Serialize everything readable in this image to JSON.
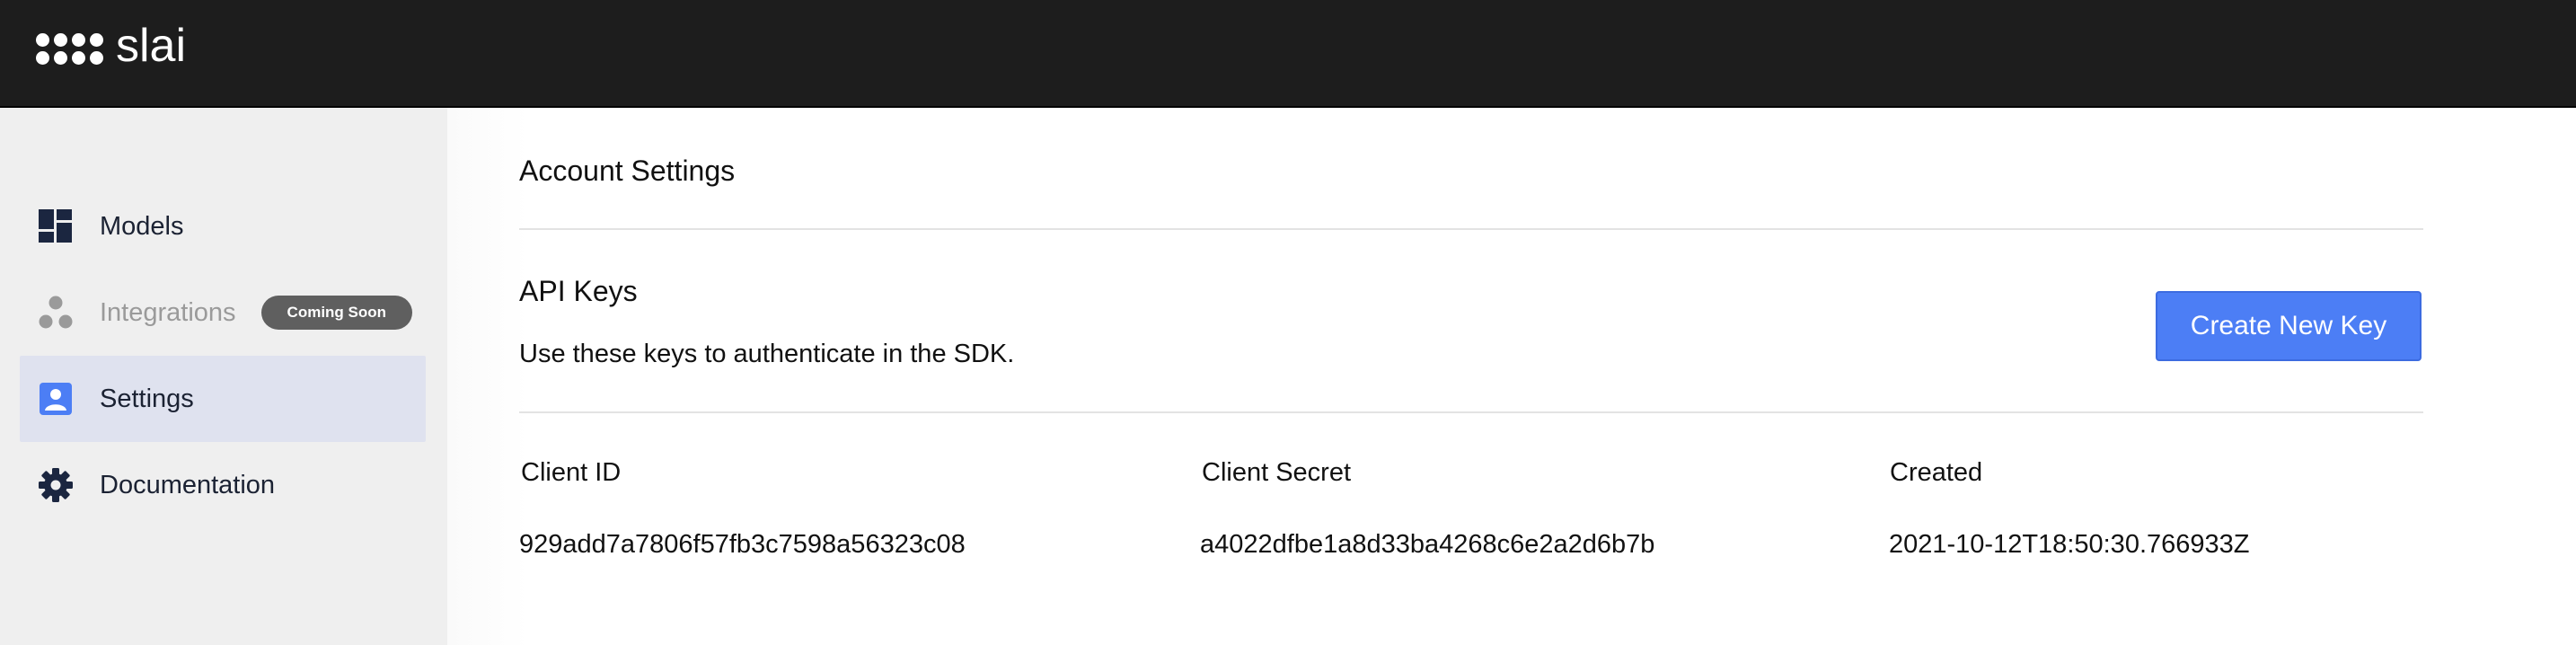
{
  "app": {
    "logo_text": "slai"
  },
  "sidebar": {
    "items": [
      {
        "label": "Models",
        "icon": "dashboard-icon"
      },
      {
        "label": "Integrations",
        "icon": "integrations-icon",
        "badge": "Coming Soon"
      },
      {
        "label": "Settings",
        "icon": "account-box-icon"
      },
      {
        "label": "Documentation",
        "icon": "gear-icon"
      }
    ]
  },
  "main": {
    "title": "Account Settings",
    "api_keys": {
      "title": "API Keys",
      "description": "Use these keys to authenticate in the SDK.",
      "create_button": "Create New Key",
      "columns": [
        "Client ID",
        "Client Secret",
        "Created"
      ],
      "rows": [
        {
          "client_id": "929add7a7806f57fb3c7598a56323c08",
          "client_secret": "a4022dfbe1a8d33ba4268c6e2a2d6b7b",
          "created": "2021-10-12T18:50:30.766933Z"
        }
      ]
    }
  },
  "colors": {
    "topbar": "#1d1d1d",
    "sidebar": "#efefef",
    "active_item": "#dfe2ef",
    "accent": "#4c7ef5",
    "badge": "#5f5f5f"
  }
}
